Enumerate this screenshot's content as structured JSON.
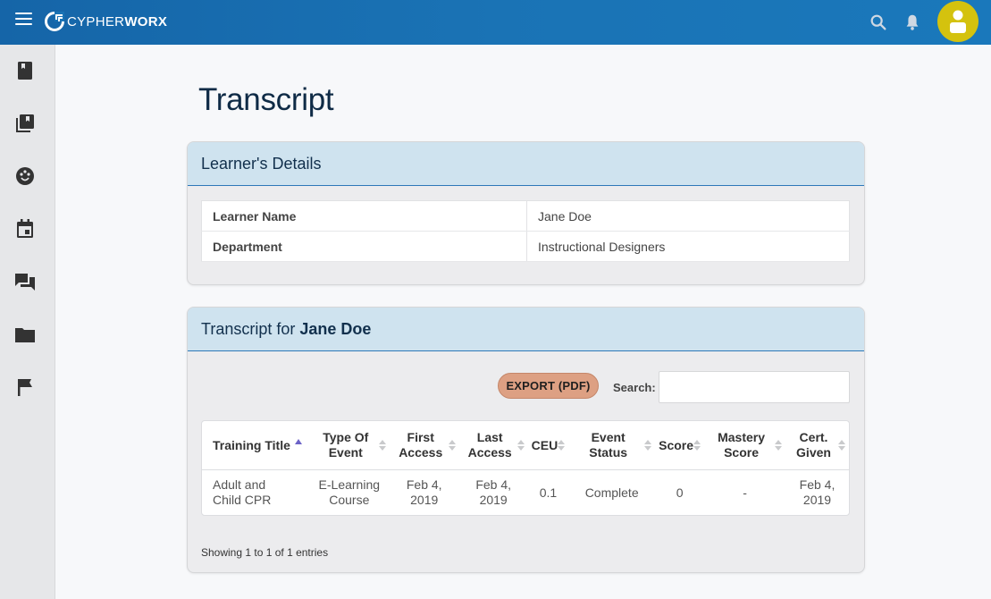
{
  "brand": {
    "name_bold": "CYPHER",
    "name_thin": "WORX"
  },
  "icons": {
    "menu": "hamburger-menu-icon",
    "search": "search-icon",
    "notifications": "bell-icon",
    "avatar": "user-avatar-icon"
  },
  "sidebar": {
    "items": [
      {
        "icon": "book-icon"
      },
      {
        "icon": "library-icon"
      },
      {
        "icon": "palette-icon"
      },
      {
        "icon": "calendar-icon"
      },
      {
        "icon": "forum-icon"
      },
      {
        "icon": "folder-icon"
      },
      {
        "icon": "flag-icon"
      }
    ]
  },
  "page": {
    "title": "Transcript"
  },
  "learner_details": {
    "header": "Learner's Details",
    "rows": [
      {
        "label": "Learner Name",
        "value": "Jane Doe"
      },
      {
        "label": "Department",
        "value": "Instructional Designers"
      }
    ]
  },
  "transcript": {
    "header_prefix": "Transcript for",
    "header_name": "Jane Doe",
    "export_label": "EXPORT (PDF)",
    "search_label": "Search:",
    "search_value": "",
    "columns": [
      {
        "line1": "Training Title",
        "line2": ""
      },
      {
        "line1": "Type Of",
        "line2": "Event"
      },
      {
        "line1": "First",
        "line2": "Access"
      },
      {
        "line1": "Last",
        "line2": "Access"
      },
      {
        "line1": "CEU",
        "line2": ""
      },
      {
        "line1": "Event",
        "line2": "Status"
      },
      {
        "line1": "Score",
        "line2": ""
      },
      {
        "line1": "Mastery",
        "line2": "Score"
      },
      {
        "line1": "Cert.",
        "line2": "Given"
      }
    ],
    "rows": [
      {
        "title_1": "Adult and",
        "title_2": "Child CPR",
        "type_1": "E-Learning",
        "type_2": "Course",
        "first_1": "Feb 4,",
        "first_2": "2019",
        "last_1": "Feb 4,",
        "last_2": "2019",
        "ceu": "0.1",
        "status": "Complete",
        "score": "0",
        "mastery": "-",
        "cert_1": "Feb 4,",
        "cert_2": "2019"
      }
    ],
    "showing": "Showing 1 to 1 of 1 entries"
  },
  "colors": {
    "topbar": "#1a73b5",
    "accent_blue": "#2d78b8",
    "export_button": "#dda083",
    "avatar": "#d4c20e",
    "card_header": "#cfe3ef"
  }
}
